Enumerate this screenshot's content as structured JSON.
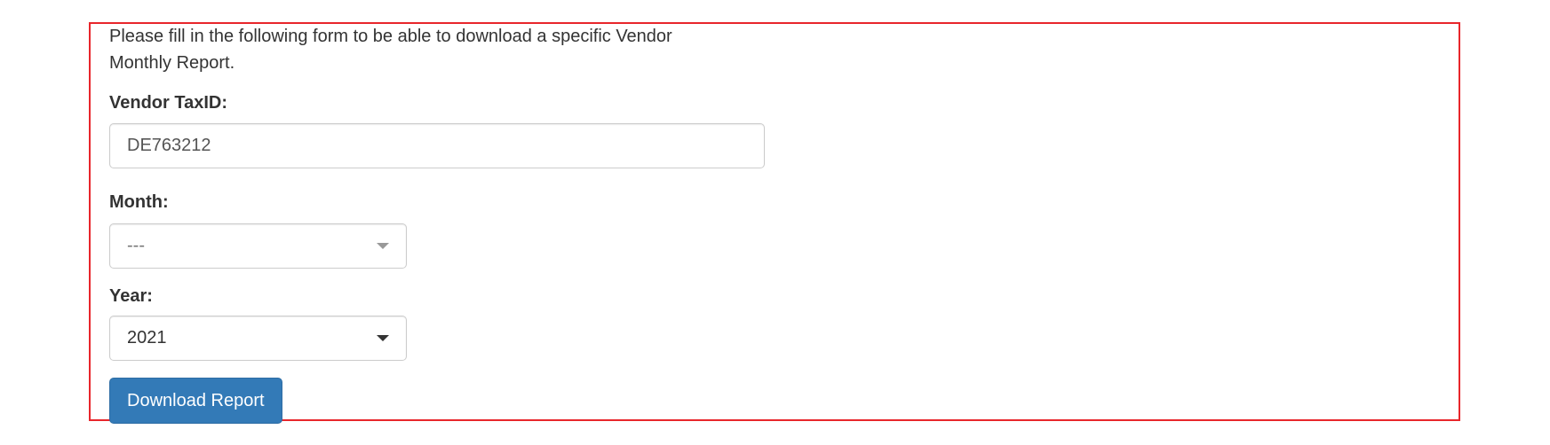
{
  "form": {
    "intro_text": "Please fill in the following form to be able to download a specific Vendor Monthly Report.",
    "vendor_taxid": {
      "label": "Vendor TaxID:",
      "value": "DE763212"
    },
    "month": {
      "label": "Month:",
      "selected": "---"
    },
    "year": {
      "label": "Year:",
      "selected": "2021"
    },
    "download_button_label": "Download Report"
  },
  "colors": {
    "frame_border": "#e8262b",
    "button_primary": "#337ab7",
    "text": "#333333"
  },
  "icons": {
    "month_dropdown": "caret-down-icon",
    "year_dropdown": "caret-down-icon"
  }
}
